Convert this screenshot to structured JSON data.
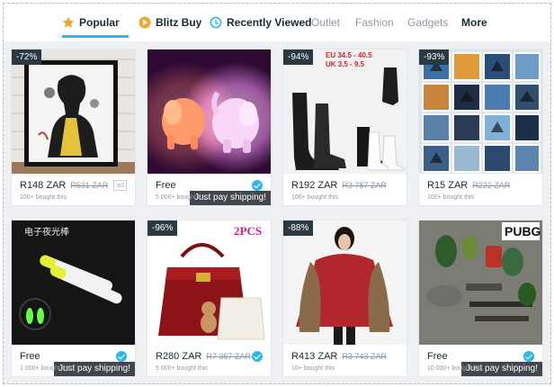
{
  "tabs": [
    {
      "label": "Popular",
      "icon": "star-icon",
      "active": true
    },
    {
      "label": "Blitz Buy",
      "icon": "blitz-icon"
    },
    {
      "label": "Recently Viewed",
      "icon": "clock-icon"
    },
    {
      "label": "Outlet"
    },
    {
      "label": "Fashion"
    },
    {
      "label": "Gadgets"
    },
    {
      "label": "More"
    }
  ],
  "colors": {
    "accent": "#2fb7ec",
    "badge": "#2b3942",
    "muted": "#8f98a5",
    "text": "#192a32"
  },
  "products": [
    {
      "name": "freddie-poster",
      "discount": "-72%",
      "price": "R148 ZAR",
      "original": "R531 ZAR",
      "bought": "100+ bought this",
      "ad": "ad",
      "overlay_text": [
        "",
        ""
      ]
    },
    {
      "name": "elephant-lamp",
      "price": "Free",
      "bought": "5 000+ bought this",
      "shipping": "Just pay shipping!",
      "verified": true
    },
    {
      "name": "boots",
      "discount": "-94%",
      "price": "R192 ZAR",
      "original": "R3 787 ZAR",
      "bought": "100+ bought this",
      "overlay_text": [
        "EU 34.5 - 40.5",
        "UK 3.5 - 9.5"
      ]
    },
    {
      "name": "pillow-cases",
      "discount": "-93%",
      "price": "R15 ZAR",
      "original": "R222 ZAR",
      "bought": "100+ bought this"
    },
    {
      "name": "glow-sticks",
      "price": "Free",
      "bought": "1 000+ bought this",
      "shipping": "Just pay shipping!",
      "verified": true,
      "image_text": "电子夜光棒"
    },
    {
      "name": "handbag-set",
      "discount": "-96%",
      "price": "R280 ZAR",
      "original": "R7 367 ZAR",
      "bought": "5 000+ bought this",
      "verified": true,
      "image_text": "2PCS"
    },
    {
      "name": "red-cape",
      "discount": "-88%",
      "price": "R413 ZAR",
      "original": "R3 743 ZAR",
      "bought": "10+ bought this"
    },
    {
      "name": "pubg-keychains",
      "price": "Free",
      "bought": "10 000+ bought this",
      "shipping": "Just pay shipping!",
      "verified": true,
      "image_text": "PUBG"
    }
  ]
}
